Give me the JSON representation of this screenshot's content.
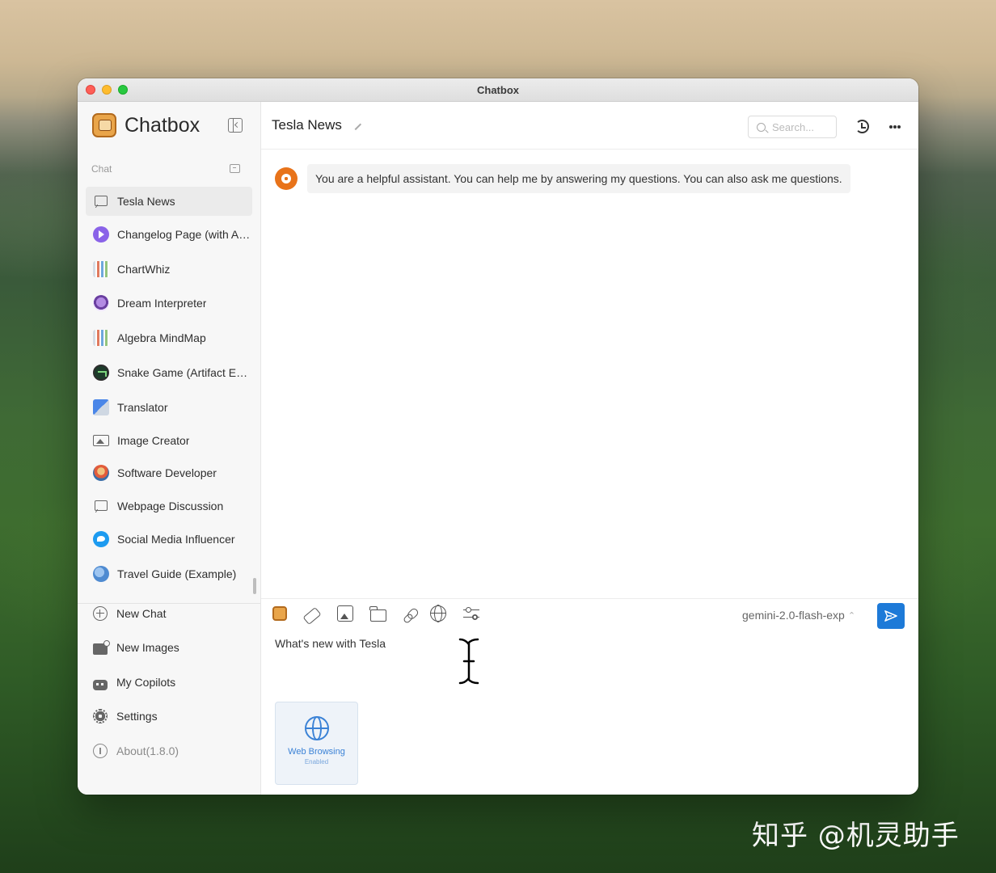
{
  "window": {
    "title": "Chatbox"
  },
  "brand": {
    "name": "Chatbox"
  },
  "sidebar": {
    "section_label": "Chat",
    "items": [
      {
        "label": "Tesla News",
        "icon": "chat-bubble-icon",
        "active": true
      },
      {
        "label": "Changelog Page (with Artifact)",
        "icon": "play-circle-icon"
      },
      {
        "label": "ChartWhiz",
        "icon": "chart-icon"
      },
      {
        "label": "Dream Interpreter",
        "icon": "crystal-ball-icon"
      },
      {
        "label": "Algebra MindMap",
        "icon": "chart-icon"
      },
      {
        "label": "Snake Game (Artifact Example)",
        "icon": "snake-icon"
      },
      {
        "label": "Translator",
        "icon": "translate-icon"
      },
      {
        "label": "Image Creator",
        "icon": "image-icon"
      },
      {
        "label": "Software Developer",
        "icon": "developer-icon"
      },
      {
        "label": "Webpage Discussion",
        "icon": "chat-bubble-icon"
      },
      {
        "label": "Social Media Influencer",
        "icon": "twitter-icon"
      },
      {
        "label": "Travel Guide (Example)",
        "icon": "globe-icon"
      }
    ],
    "nav": [
      {
        "label": "New Chat",
        "icon": "plus-circle-icon"
      },
      {
        "label": "New Images",
        "icon": "new-image-icon"
      },
      {
        "label": "My Copilots",
        "icon": "robot-icon"
      },
      {
        "label": "Settings",
        "icon": "gear-icon"
      },
      {
        "label": "About(1.8.0)",
        "icon": "info-icon"
      }
    ]
  },
  "header": {
    "title": "Tesla News",
    "search_placeholder": "Search..."
  },
  "messages": [
    {
      "role": "system",
      "text": "You are a helpful assistant. You can help me by answering my questions. You can also ask me questions."
    }
  ],
  "composer": {
    "model": "gemini-2.0-flash-exp",
    "input_value": "What's new with Tesla",
    "web_card_title": "Web Browsing",
    "web_card_status": "Enabled"
  },
  "watermark": "知乎 @机灵助手",
  "colors": {
    "accent": "#1d7ad8",
    "avatar": "#e8731a"
  }
}
